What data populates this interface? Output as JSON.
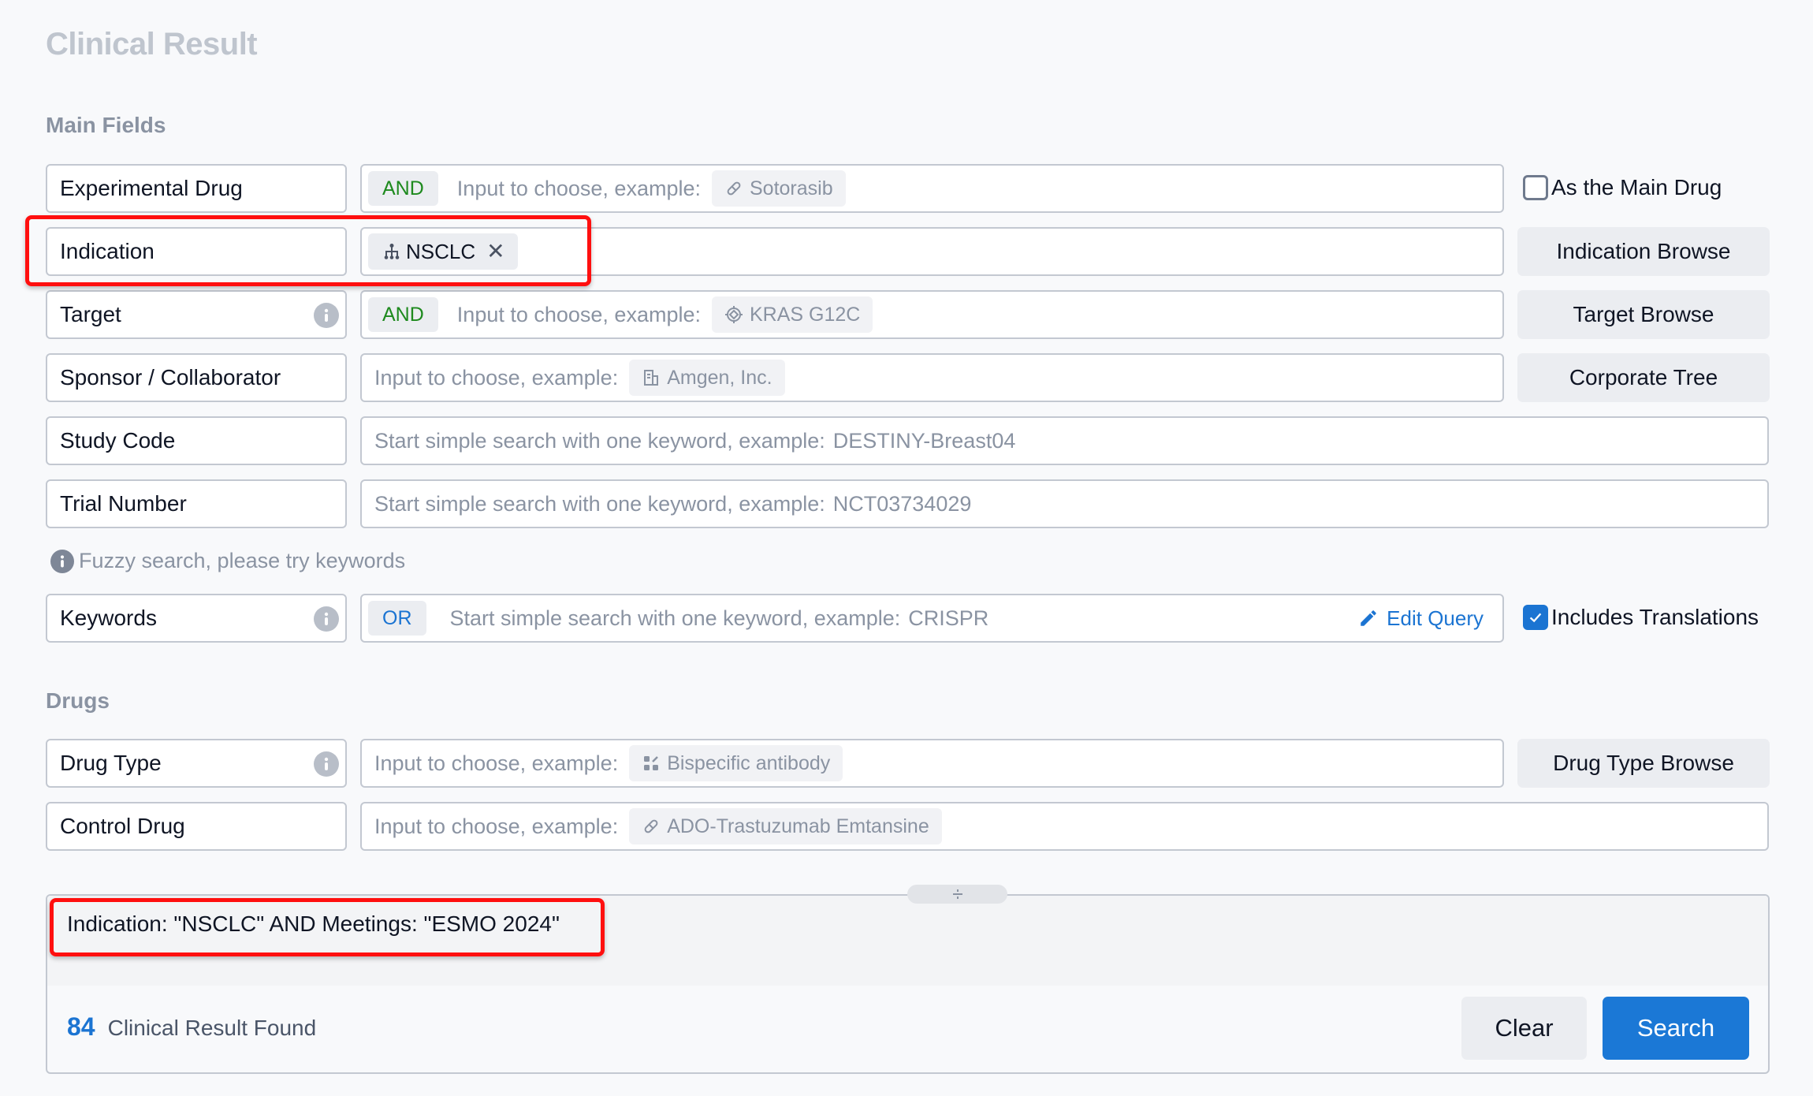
{
  "page": {
    "title": "Clinical Result"
  },
  "sections": {
    "main_fields": "Main Fields",
    "drugs": "Drugs"
  },
  "fields": {
    "experimental_drug": {
      "label": "Experimental Drug",
      "operator": "AND",
      "placeholder": "Input to choose, example:",
      "example": "Sotorasib",
      "example_icon": "pill-icon"
    },
    "indication": {
      "label": "Indication",
      "tag": "NSCLC",
      "tag_icon": "hierarchy-icon"
    },
    "target": {
      "label": "Target",
      "operator": "AND",
      "placeholder": "Input to choose, example:",
      "example": "KRAS G12C",
      "example_icon": "target-icon"
    },
    "sponsor": {
      "label": "Sponsor / Collaborator",
      "placeholder": "Input to choose, example:",
      "example": "Amgen, Inc.",
      "example_icon": "building-icon"
    },
    "study_code": {
      "label": "Study Code",
      "placeholder": "Start simple search with one keyword, example:",
      "example": "DESTINY-Breast04"
    },
    "trial_number": {
      "label": "Trial Number",
      "placeholder": "Start simple search with one keyword, example:",
      "example": "NCT03734029"
    },
    "keywords": {
      "label": "Keywords",
      "operator": "OR",
      "placeholder": "Start simple search with one keyword, example:",
      "example": "CRISPR",
      "edit_query": "Edit Query"
    },
    "drug_type": {
      "label": "Drug Type",
      "placeholder": "Input to choose, example:",
      "example": "Bispecific antibody",
      "example_icon": "antibody-icon"
    },
    "control_drug": {
      "label": "Control Drug",
      "placeholder": "Input to choose, example:",
      "example": "ADO-Trastuzumab Emtansine",
      "example_icon": "pill-icon"
    }
  },
  "side": {
    "as_main_drug": {
      "label": "As the Main Drug",
      "checked": false
    },
    "indication_browse": "Indication Browse",
    "target_browse": "Target Browse",
    "corporate_tree": "Corporate Tree",
    "includes_translations": {
      "label": "Includes Translations",
      "checked": true
    },
    "drug_type_browse": "Drug Type Browse"
  },
  "hint": {
    "fuzzy": "Fuzzy search, please try keywords"
  },
  "query": {
    "text": "Indication: \"NSCLC\" AND Meetings: \"ESMO 2024\"",
    "result_count": "84",
    "result_label": "Clinical Result Found",
    "clear": "Clear",
    "search": "Search"
  },
  "colors": {
    "accent": "#1b74d2",
    "and_operator": "#1e8a1e",
    "highlight": "#ff0f0f"
  }
}
